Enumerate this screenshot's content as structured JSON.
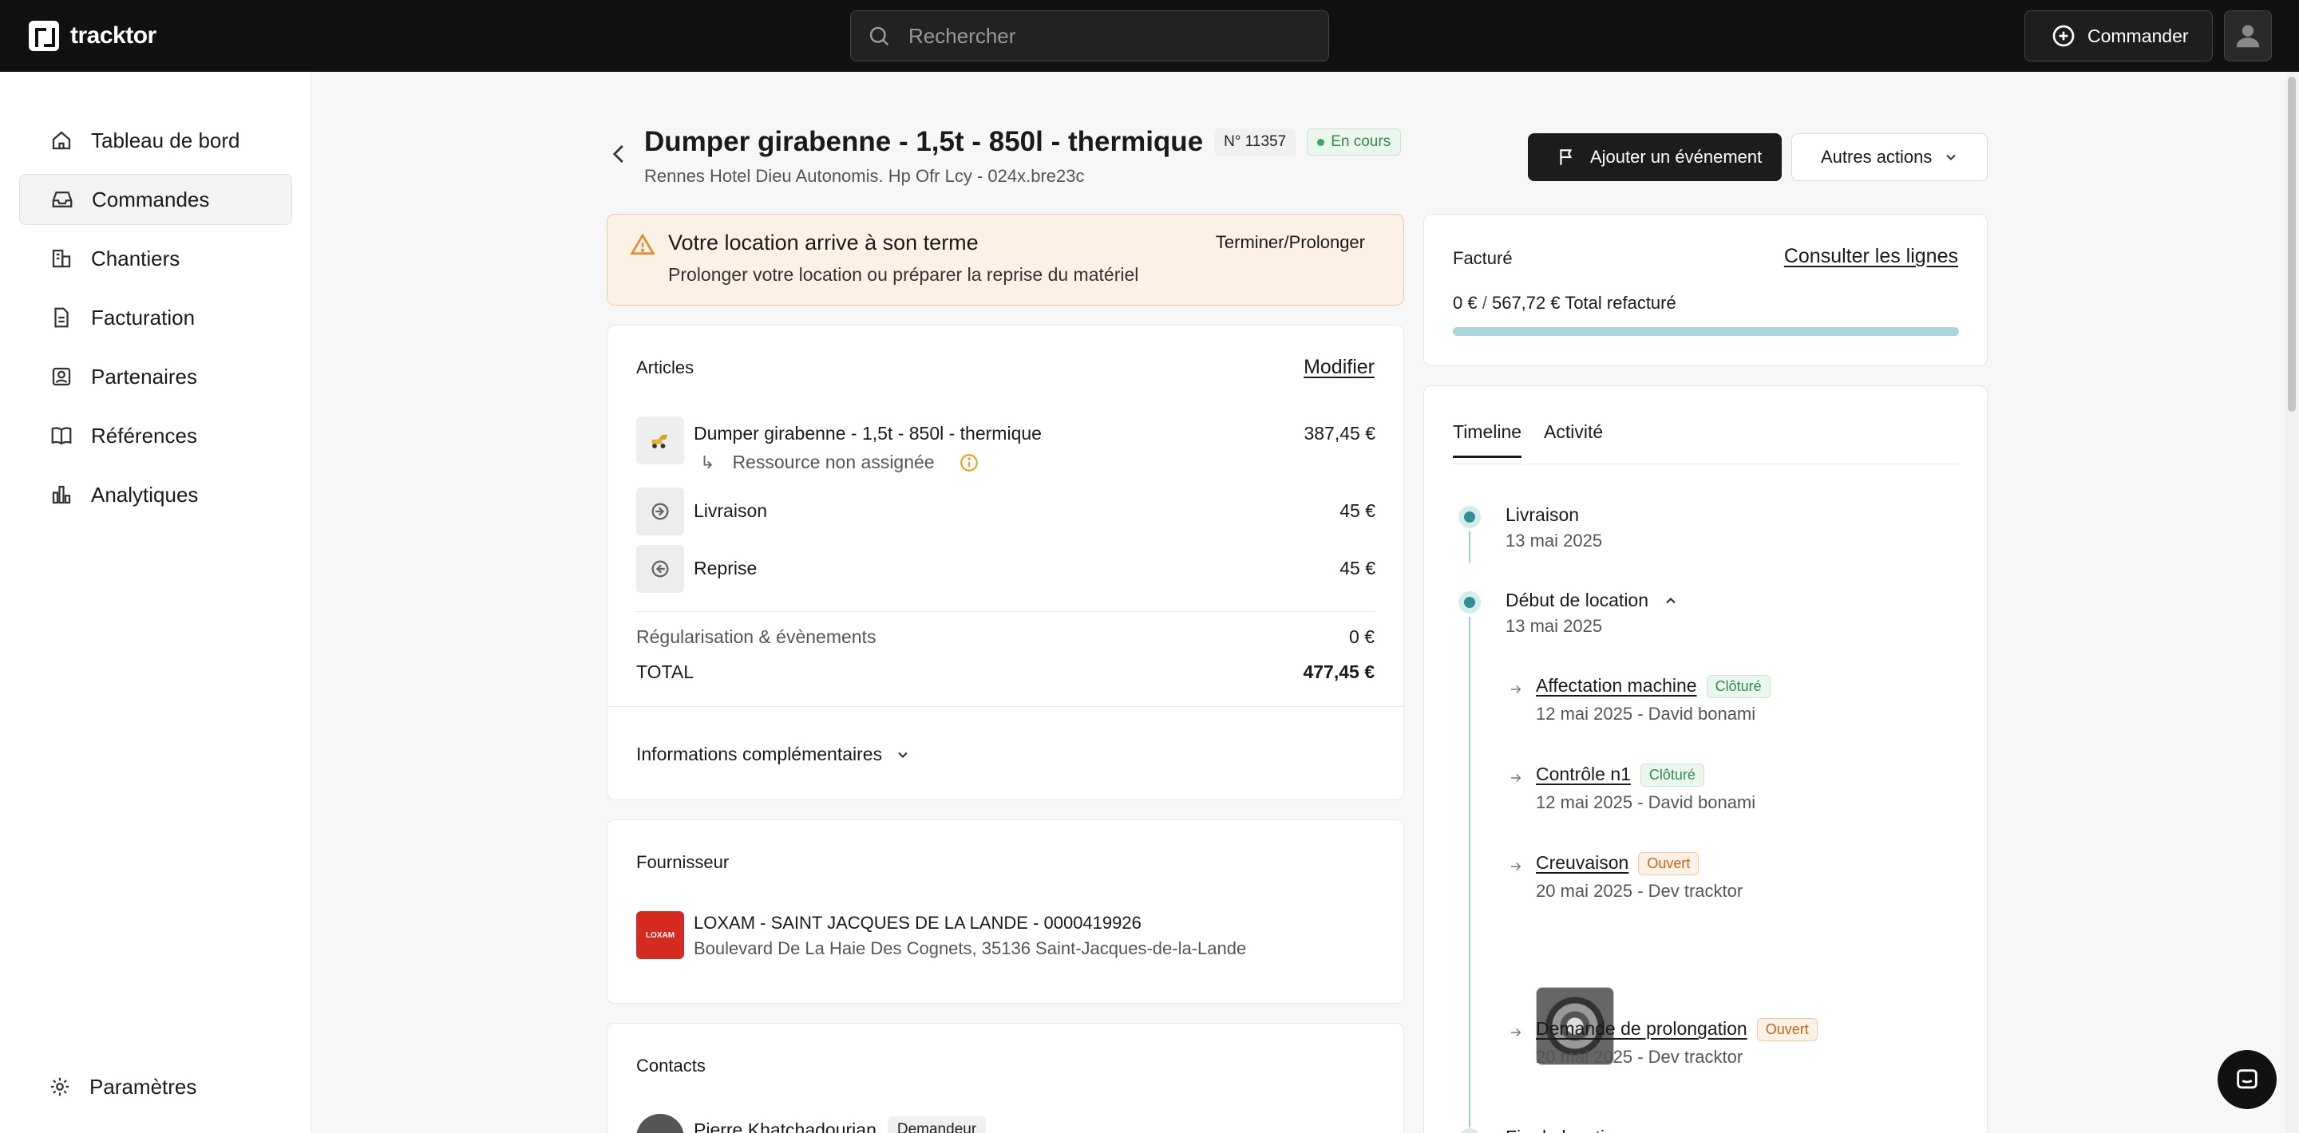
{
  "app": {
    "name": "tracktor"
  },
  "search": {
    "placeholder": "Rechercher"
  },
  "topbar": {
    "order_button": "Commander"
  },
  "sidebar": {
    "items": [
      {
        "label": "Tableau de bord",
        "icon": "home-icon"
      },
      {
        "label": "Commandes",
        "icon": "inbox-icon",
        "active": true
      },
      {
        "label": "Chantiers",
        "icon": "building-icon"
      },
      {
        "label": "Facturation",
        "icon": "document-icon"
      },
      {
        "label": "Partenaires",
        "icon": "contact-icon"
      },
      {
        "label": "Références",
        "icon": "book-icon"
      },
      {
        "label": "Analytiques",
        "icon": "chart-icon"
      }
    ],
    "settings": "Paramètres"
  },
  "order": {
    "title": "Dumper girabenne - 1,5t - 850l - thermique",
    "number": "N° 11357",
    "status": "En cours",
    "subtitle": "Rennes Hotel Dieu Autonomis. Hp Ofr Lcy - 024x.bre23c",
    "add_event": "Ajouter un événement",
    "other_actions": "Autres actions"
  },
  "alert": {
    "title": "Votre location arrive à son terme",
    "text": "Prolonger votre location ou préparer la reprise du matériel",
    "action": "Terminer/Prolonger"
  },
  "articles": {
    "title": "Articles",
    "edit": "Modifier",
    "main_item": "Dumper girabenne - 1,5t - 850l - thermique",
    "main_price": "387,45 €",
    "resource": "Ressource non assignée",
    "delivery": "Livraison",
    "delivery_price": "45 €",
    "pickup": "Reprise",
    "pickup_price": "45 €",
    "regularisation": "Régularisation & évènements",
    "regularisation_price": "0 €",
    "total_label": "TOTAL",
    "total_price": "477,45 €",
    "more_info": "Informations complémentaires"
  },
  "supplier": {
    "title": "Fournisseur",
    "logo_text": "LOXAM",
    "name": "LOXAM - SAINT JACQUES DE LA LANDE - 0000419926",
    "address": "Boulevard De La Haie Des Cognets, 35136 Saint-Jacques-de-la-Lande"
  },
  "contacts": {
    "title": "Contacts",
    "name": "Pierre Khatchadourian",
    "role": "Demandeur"
  },
  "billing": {
    "title": "Facturé",
    "link": "Consulter les lignes",
    "billed": "0 €",
    "separator": "/",
    "total": "567,72 € Total refacturé",
    "progress": 0.0
  },
  "timeline": {
    "tabs": [
      "Timeline",
      "Activité"
    ],
    "events": [
      {
        "title": "Livraison",
        "date": "13 mai 2025"
      },
      {
        "title": "Début de location",
        "date": "13 mai 2025"
      },
      {
        "title": "Fin de location",
        "date": ""
      }
    ],
    "sub_events": [
      {
        "title": "Affectation machine",
        "status": "Clôturé",
        "meta": "12 mai 2025 - David bonami"
      },
      {
        "title": "Contrôle n1",
        "status": "Clôturé",
        "meta": "12 mai 2025 - David bonami"
      },
      {
        "title": "Creuvaison",
        "status": "Ouvert",
        "meta": "20 mai 2025 - Dev tracktor"
      },
      {
        "title": "Demande de prolongation",
        "status": "Ouvert",
        "meta": "20 mai 2025 - Dev tracktor"
      }
    ]
  },
  "colors": {
    "accent": "#2f8f94",
    "warning_bg": "#fdf0e4",
    "success": "#2e8b4f",
    "topbar": "#111111"
  }
}
